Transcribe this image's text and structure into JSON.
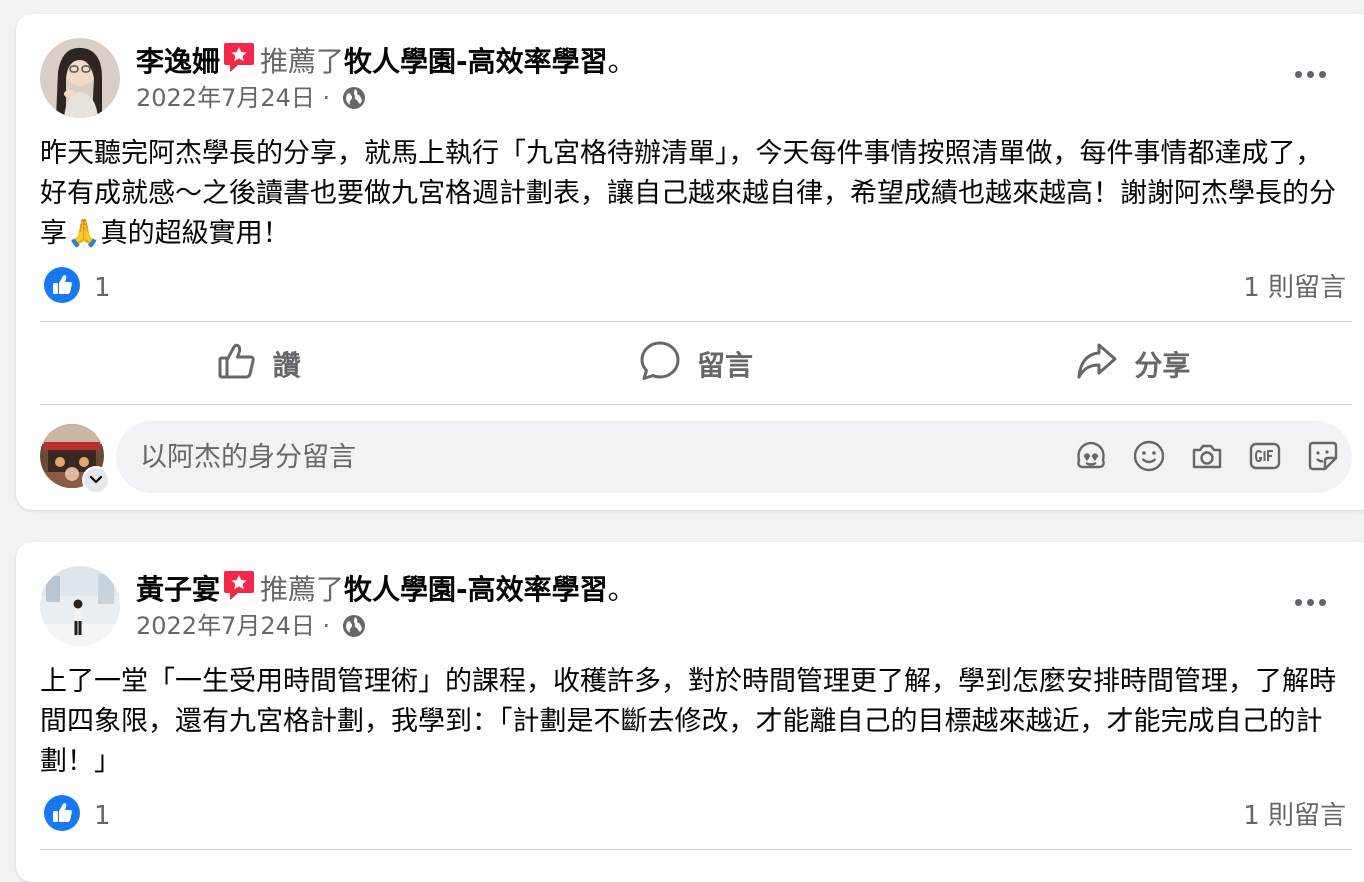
{
  "posts": [
    {
      "author": "李逸姍",
      "recommend_text": "推薦了",
      "page_name": "牧人學園-高效率學習",
      "trailing": "。",
      "date": "2022年7月24日",
      "meta_separator": "·",
      "body_before_emoji": "昨天聽完阿杰學長的分享，就馬上執行「九宮格待辦清單」，今天每件事情按照清單做，每件事情都達成了，好有成就感～之後讀書也要做九宮格週計劃表，讓自己越來越自律，希望成績也越來越高！謝謝阿杰學長的分享",
      "emoji": "🙏",
      "body_after_emoji": "真的超級實用！",
      "like_count": "1",
      "comment_count": "1 則留言"
    },
    {
      "author": "黃子宴",
      "recommend_text": "推薦了",
      "page_name": "牧人學園-高效率學習",
      "trailing": "。",
      "date": "2022年7月24日",
      "meta_separator": "·",
      "body": "上了一堂「一生受用時間管理術」的課程，收穫許多，對於時間管理更了解，學到怎麼安排時間管理，了解時間四象限，還有九宮格計劃，我學到：「計劃是不斷去修改，才能離自己的目標越來越近，才能完成自己的計劃！」",
      "like_count": "1",
      "comment_count": "1 則留言"
    }
  ],
  "actions": {
    "like": "讚",
    "comment": "留言",
    "share": "分享"
  },
  "composer": {
    "placeholder": "以阿杰的身分留言"
  },
  "colors": {
    "like_blue": "#1877f2",
    "secondary_text": "#65676b",
    "badge_red": "#f02849"
  },
  "icons": [
    "recommend-badge-icon",
    "globe-icon",
    "more-options-icon",
    "like-reaction-icon",
    "like-outline-icon",
    "comment-bubble-icon",
    "share-arrow-icon",
    "avatar-sticker-icon",
    "emoji-icon",
    "camera-icon",
    "gif-icon",
    "sticker-icon",
    "chevron-down-icon"
  ]
}
